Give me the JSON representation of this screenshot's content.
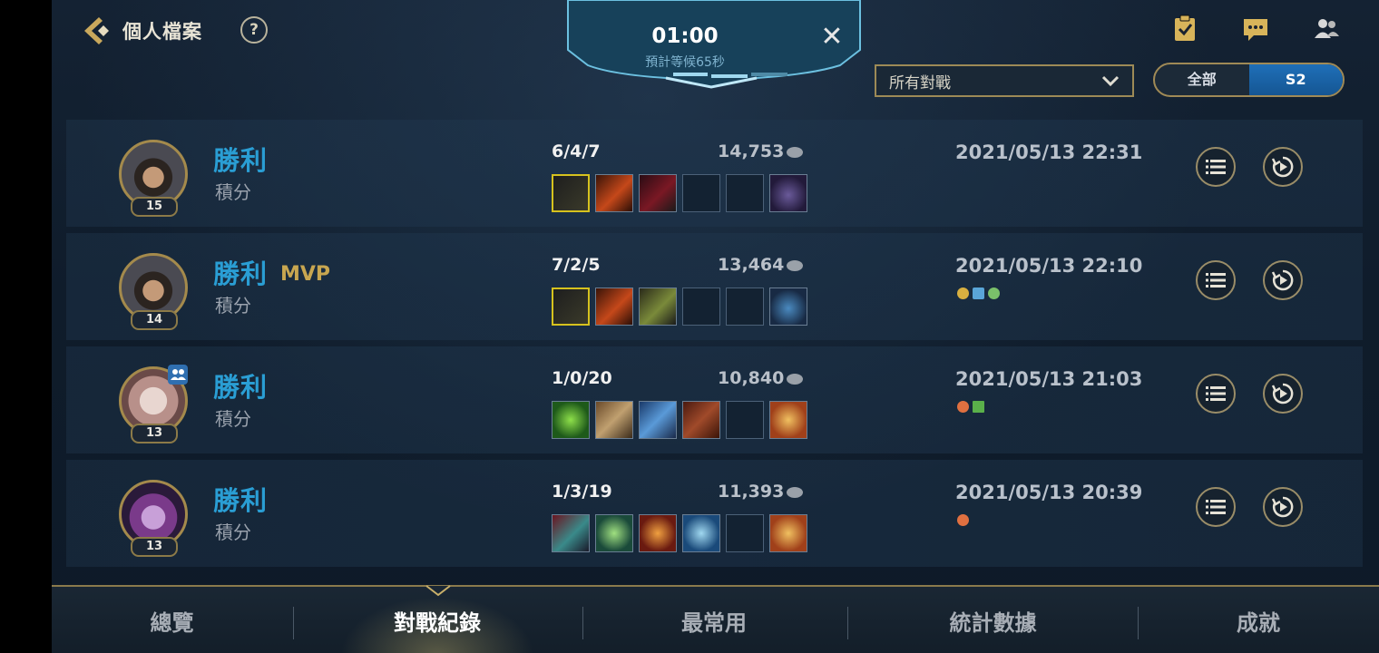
{
  "header": {
    "title": "個人檔案",
    "help_icon_text": "?",
    "icons": [
      "back-chevron-icon",
      "help-icon",
      "clipboard-check-icon",
      "chat-icon",
      "friends-icon"
    ]
  },
  "queue": {
    "timer": "01:00",
    "estimate": "預計等候65秒",
    "close_glyph": "✕"
  },
  "filters": {
    "match_type": "所有對戰",
    "season_tabs": [
      "全部",
      "S2"
    ],
    "active_season": "S2"
  },
  "matches": [
    {
      "result": "勝利",
      "mvp": "",
      "mode": "積分",
      "level": "15",
      "kda": "6/4/7",
      "gold": "14,753",
      "datetime": "2021/05/13 22:31",
      "party": false,
      "medals": []
    },
    {
      "result": "勝利",
      "mvp": "MVP",
      "mode": "積分",
      "level": "14",
      "kda": "7/2/5",
      "gold": "13,464",
      "datetime": "2021/05/13 22:10",
      "party": false,
      "medals": [
        "gold-coins-icon",
        "tower-icon",
        "dragon-icon"
      ]
    },
    {
      "result": "勝利",
      "mvp": "",
      "mode": "積分",
      "level": "13",
      "kda": "1/0/20",
      "gold": "10,840",
      "datetime": "2021/05/13 21:03",
      "party": true,
      "medals": [
        "assist-icon",
        "flag-icon"
      ]
    },
    {
      "result": "勝利",
      "mvp": "",
      "mode": "積分",
      "level": "13",
      "kda": "1/3/19",
      "gold": "11,393",
      "datetime": "2021/05/13 20:39",
      "party": false,
      "medals": [
        "assist-icon"
      ]
    }
  ],
  "colors": {
    "accent_gold": "#a48a4c",
    "win_blue": "#2a9ed4",
    "tab_active": "#1f6fb8"
  },
  "nav": {
    "tabs": [
      "總覽",
      "對戰紀錄",
      "最常用",
      "統計數據",
      "成就"
    ],
    "active": "對戰紀錄"
  }
}
